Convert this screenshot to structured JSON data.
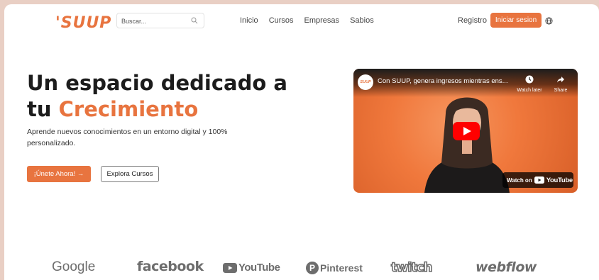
{
  "header": {
    "logo": "'SUUP",
    "search": {
      "placeholder": "Buscar..."
    },
    "nav": [
      "Inicio",
      "Cursos",
      "Empresas",
      "Sabios"
    ],
    "register_label": "Registro",
    "login_label": "Iniciar sesion"
  },
  "hero": {
    "title_line1": "Un espacio dedicado a",
    "title_line2_prefix": "tu ",
    "title_line2_accent": "Crecimiento",
    "subtitle": "Aprende nuevos conocimientos en un entorno digital y 100% personalizado.",
    "primary_button": "¡Únete Ahora! →",
    "secondary_button": "Explora Cursos"
  },
  "video": {
    "channel_logo": "SUUP",
    "title": "Con SUUP, genera ingresos mientras ens...",
    "watch_later": "Watch later",
    "share": "Share",
    "watch_on": "Watch on",
    "youtube_word": "YouTube"
  },
  "partners": [
    "Google",
    "facebook",
    "YouTube",
    "Pinterest",
    "twitch",
    "webflow"
  ],
  "colors": {
    "accent": "#e8743f",
    "background": "#e9cfc4",
    "logo_gray": "#6d6d6d"
  }
}
